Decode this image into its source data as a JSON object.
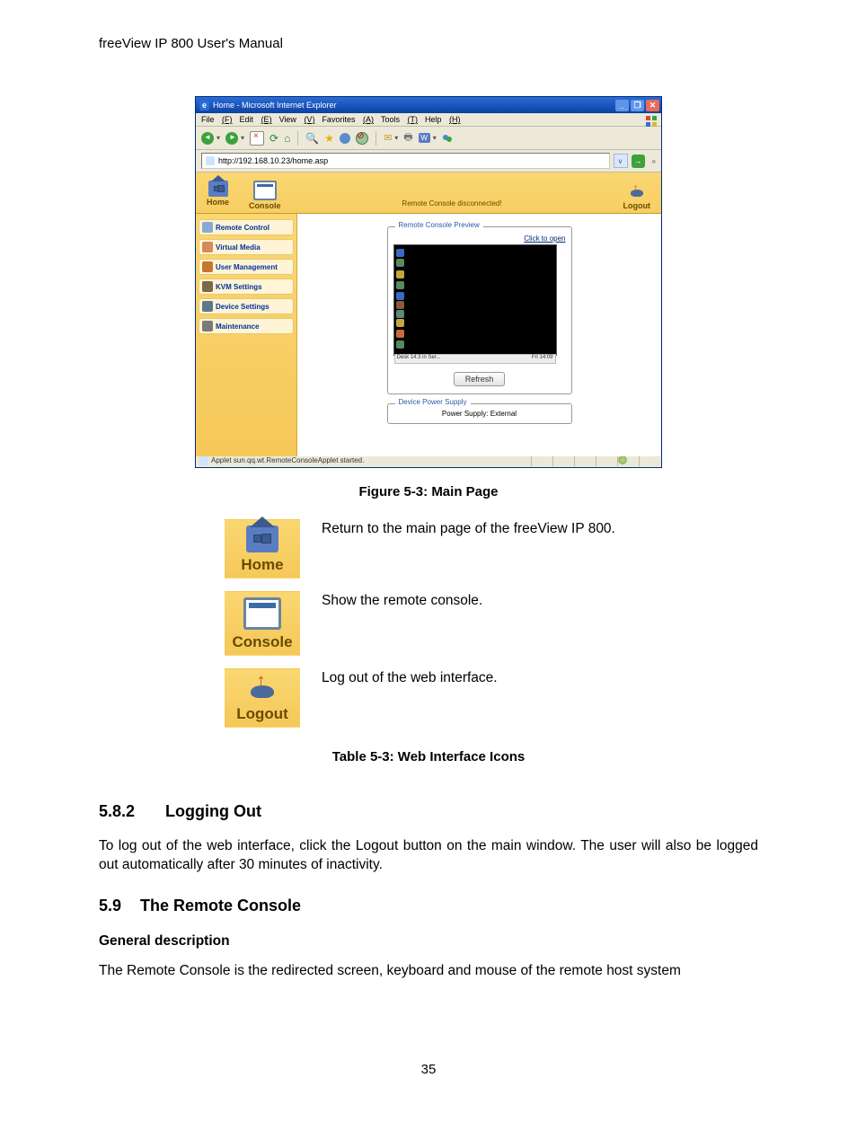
{
  "document_header": "freeView IP 800 User's Manual",
  "browser": {
    "title": "Home - Microsoft Internet Explorer",
    "menu": {
      "file": "File",
      "edit": "Edit",
      "view": "View",
      "favorites": "Favorites",
      "tools": "Tools",
      "help": "Help"
    },
    "address": "http://192.168.10.23/home.asp",
    "go_label": "→",
    "address_dropdown": "v"
  },
  "app": {
    "top_nav": {
      "home": "Home",
      "console": "Console",
      "logout": "Logout"
    },
    "status": "Remote Console disconnected!",
    "side_nav": [
      "Remote Control",
      "Virtual Media",
      "User Management",
      "KVM Settings",
      "Device Settings",
      "Maintenance"
    ],
    "preview_legend": "Remote Console Preview",
    "click_to_open": "Click to open",
    "refresh": "Refresh",
    "power_legend": "Device Power Supply",
    "power_text": "Power Supply: External",
    "footer_left": "Desk 14.3 in Ser...",
    "footer_right": "Fri 14:09"
  },
  "status_bar": "Applet sun.qq.wt.RemoteConsoleApplet started.",
  "figure_caption": "Figure 5-3: Main Page",
  "icon_table": [
    {
      "label": "Home",
      "desc": "Return to the main page of the freeView IP 800."
    },
    {
      "label": "Console",
      "desc": "Show the remote console."
    },
    {
      "label": "Logout",
      "desc": "Log out of the web interface."
    }
  ],
  "table_caption": "Table 5-3: Web Interface Icons",
  "sections": {
    "s582_num": "5.8.2",
    "s582_title": "Logging Out",
    "s582_body": "To log out of the web interface, click the Logout button on the main window. The user will also be logged out automatically after 30 minutes of inactivity.",
    "s59_num": "5.9",
    "s59_title": "The Remote Console",
    "s59_sub": "General description",
    "s59_body": "The Remote Console is the redirected screen, keyboard and mouse of the remote host system"
  },
  "page_number": "35"
}
